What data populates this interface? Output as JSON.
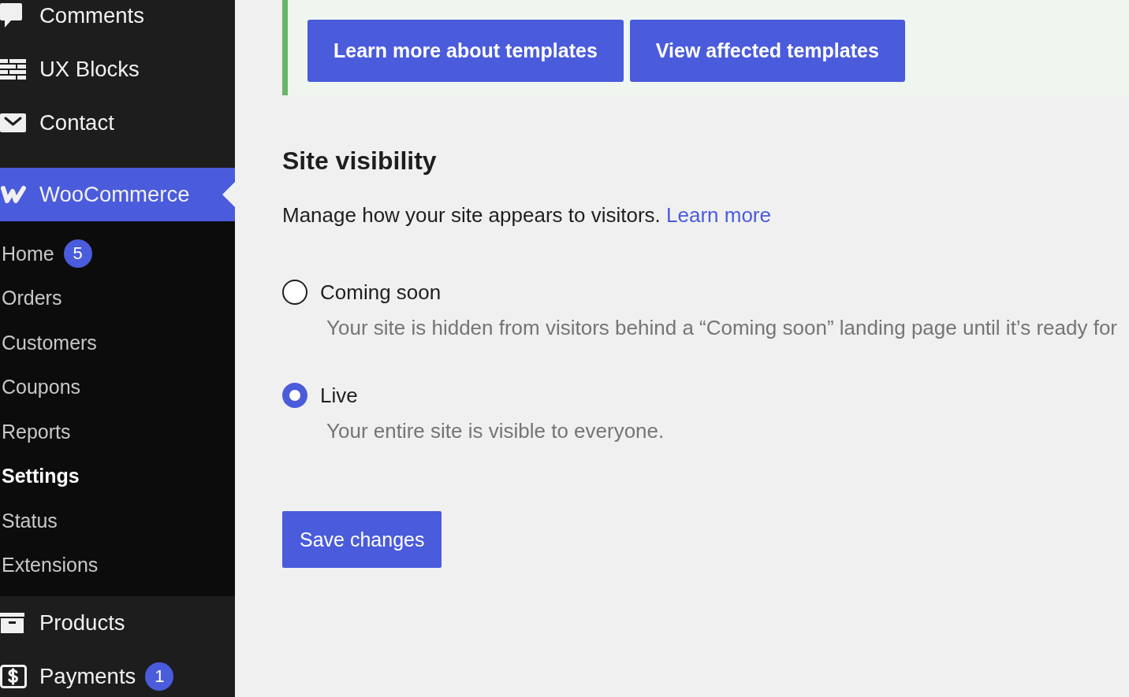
{
  "sidebar": {
    "menu": [
      {
        "label": "Comments",
        "selected": false
      },
      {
        "label": "UX Blocks",
        "selected": false
      },
      {
        "label": "Contact",
        "selected": false
      },
      {
        "label": "WooCommerce",
        "selected": true,
        "children": [
          {
            "label": "Home",
            "badge": "5",
            "selected": false
          },
          {
            "label": "Orders",
            "selected": false
          },
          {
            "label": "Customers",
            "selected": false
          },
          {
            "label": "Coupons",
            "selected": false
          },
          {
            "label": "Reports",
            "selected": false
          },
          {
            "label": "Settings",
            "selected": true
          },
          {
            "label": "Status",
            "selected": false
          },
          {
            "label": "Extensions",
            "selected": false
          }
        ]
      },
      {
        "label": "Products",
        "selected": false
      },
      {
        "label": "Payments",
        "badge": "1",
        "selected": false
      }
    ]
  },
  "notice": {
    "buttons": [
      "Learn more about templates",
      "View affected templates"
    ]
  },
  "site_visibility": {
    "title": "Site visibility",
    "description": "Manage how your site appears to visitors.",
    "link": "Learn more",
    "options": [
      {
        "label": "Coming soon",
        "description": "Your site is hidden from visitors behind a “Coming soon” landing page until it’s ready for",
        "selected": false
      },
      {
        "label": "Live",
        "description": "Your entire site is visible to everyone.",
        "selected": true
      }
    ],
    "save_button": "Save changes"
  }
}
